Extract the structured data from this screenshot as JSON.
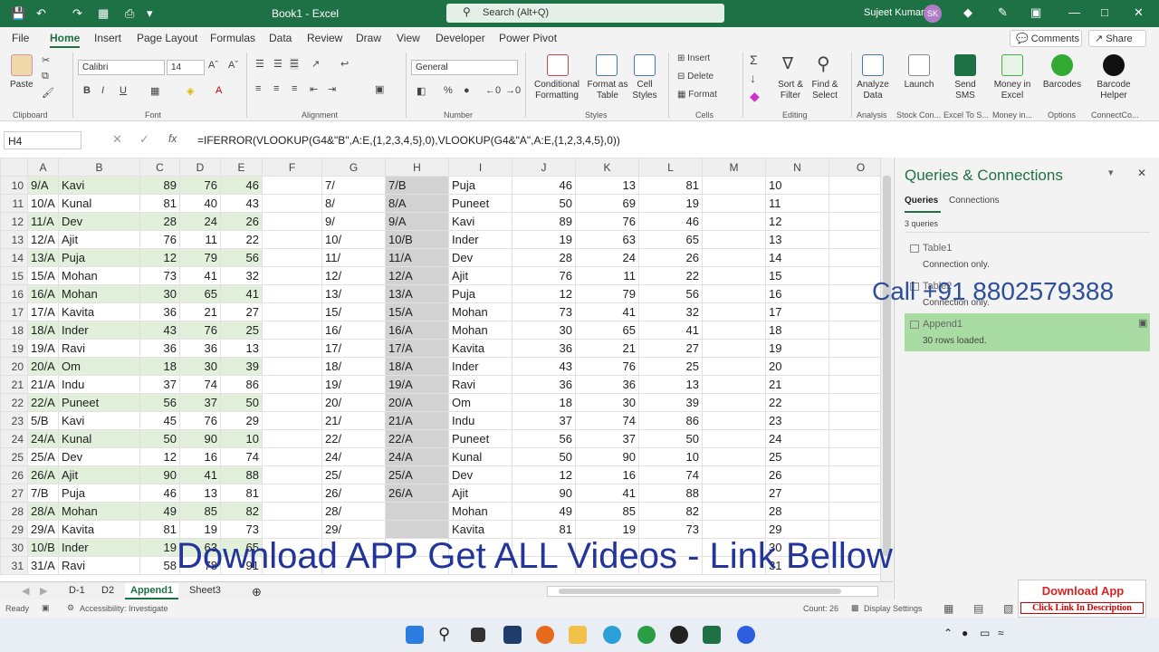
{
  "titlebar": {
    "doc_title": "Book1  -  Excel",
    "search_placeholder": "Search (Alt+Q)",
    "user": "Sujeet Kumar",
    "avatar": "SK"
  },
  "menu": {
    "tabs": [
      "File",
      "Home",
      "Insert",
      "Page Layout",
      "Formulas",
      "Data",
      "Review",
      "Draw",
      "View",
      "Developer",
      "Power Pivot"
    ],
    "comments": "Comments",
    "share": "Share"
  },
  "ribbon": {
    "clipboard": {
      "paste": "Paste",
      "label": "Clipboard"
    },
    "font": {
      "name": "Calibri",
      "size": "14",
      "label": "Font"
    },
    "alignment": {
      "label": "Alignment"
    },
    "number": {
      "format": "General",
      "label": "Number"
    },
    "styles": {
      "cond": "Conditional Formatting",
      "table": "Format as Table",
      "cell": "Cell Styles",
      "label": "Styles"
    },
    "cells": {
      "insert": "Insert",
      "delete": "Delete",
      "format": "Format",
      "label": "Cells"
    },
    "editing": {
      "sort": "Sort & Filter",
      "find": "Find & Select",
      "label": "Editing"
    },
    "analysis": {
      "btn": "Analyze Data",
      "label": "Analysis"
    },
    "stock": {
      "btn": "Launch",
      "label": "Stock Con..."
    },
    "sms": {
      "btn": "Send SMS",
      "label": "Excel To S..."
    },
    "money": {
      "btn": "Money in Excel",
      "label": "Money in..."
    },
    "options": {
      "btn": "Barcodes",
      "label": "Options"
    },
    "connect": {
      "btn": "Barcode Helper",
      "label": "ConnectCo..."
    }
  },
  "formula": {
    "cell": "H4",
    "value": "=IFERROR(VLOOKUP(G4&\"B\",A:E,{1,2,3,4,5},0),VLOOKUP(G4&\"A\",A:E,{1,2,3,4,5},0))"
  },
  "grid": {
    "columns": [
      "A",
      "B",
      "C",
      "D",
      "E",
      "F",
      "G",
      "H",
      "I",
      "J",
      "K",
      "L",
      "M",
      "N",
      "O"
    ],
    "rows": [
      {
        "n": "10",
        "a": "9/A",
        "b": "Kavi",
        "c": "89",
        "d": "76",
        "e": "46",
        "g": "7/",
        "h": "7/B",
        "i": "Puja",
        "j": "46",
        "k": "13",
        "l": "81"
      },
      {
        "n": "11",
        "a": "10/A",
        "b": "Kunal",
        "c": "81",
        "d": "40",
        "e": "43",
        "g": "8/",
        "h": "8/A",
        "i": "Puneet",
        "j": "50",
        "k": "69",
        "l": "19"
      },
      {
        "n": "12",
        "a": "11/A",
        "b": "Dev",
        "c": "28",
        "d": "24",
        "e": "26",
        "g": "9/",
        "h": "9/A",
        "i": "Kavi",
        "j": "89",
        "k": "76",
        "l": "46"
      },
      {
        "n": "13",
        "a": "12/A",
        "b": "Ajit",
        "c": "76",
        "d": "11",
        "e": "22",
        "g": "10/",
        "h": "10/B",
        "i": "Inder",
        "j": "19",
        "k": "63",
        "l": "65"
      },
      {
        "n": "14",
        "a": "13/A",
        "b": "Puja",
        "c": "12",
        "d": "79",
        "e": "56",
        "g": "11/",
        "h": "11/A",
        "i": "Dev",
        "j": "28",
        "k": "24",
        "l": "26"
      },
      {
        "n": "15",
        "a": "15/A",
        "b": "Mohan",
        "c": "73",
        "d": "41",
        "e": "32",
        "g": "12/",
        "h": "12/A",
        "i": "Ajit",
        "j": "76",
        "k": "11",
        "l": "22"
      },
      {
        "n": "16",
        "a": "16/A",
        "b": "Mohan",
        "c": "30",
        "d": "65",
        "e": "41",
        "g": "13/",
        "h": "13/A",
        "i": "Puja",
        "j": "12",
        "k": "79",
        "l": "56"
      },
      {
        "n": "17",
        "a": "17/A",
        "b": "Kavita",
        "c": "36",
        "d": "21",
        "e": "27",
        "g": "15/",
        "h": "15/A",
        "i": "Mohan",
        "j": "73",
        "k": "41",
        "l": "32"
      },
      {
        "n": "18",
        "a": "18/A",
        "b": "Inder",
        "c": "43",
        "d": "76",
        "e": "25",
        "g": "16/",
        "h": "16/A",
        "i": "Mohan",
        "j": "30",
        "k": "65",
        "l": "41"
      },
      {
        "n": "19",
        "a": "19/A",
        "b": "Ravi",
        "c": "36",
        "d": "36",
        "e": "13",
        "g": "17/",
        "h": "17/A",
        "i": "Kavita",
        "j": "36",
        "k": "21",
        "l": "27"
      },
      {
        "n": "20",
        "a": "20/A",
        "b": "Om",
        "c": "18",
        "d": "30",
        "e": "39",
        "g": "18/",
        "h": "18/A",
        "i": "Inder",
        "j": "43",
        "k": "76",
        "l": "25"
      },
      {
        "n": "21",
        "a": "21/A",
        "b": "Indu",
        "c": "37",
        "d": "74",
        "e": "86",
        "g": "19/",
        "h": "19/A",
        "i": "Ravi",
        "j": "36",
        "k": "36",
        "l": "13"
      },
      {
        "n": "22",
        "a": "22/A",
        "b": "Puneet",
        "c": "56",
        "d": "37",
        "e": "50",
        "g": "20/",
        "h": "20/A",
        "i": "Om",
        "j": "18",
        "k": "30",
        "l": "39"
      },
      {
        "n": "23",
        "a": "5/B",
        "b": "Kavi",
        "c": "45",
        "d": "76",
        "e": "29",
        "g": "21/",
        "h": "21/A",
        "i": "Indu",
        "j": "37",
        "k": "74",
        "l": "86"
      },
      {
        "n": "24",
        "a": "24/A",
        "b": "Kunal",
        "c": "50",
        "d": "90",
        "e": "10",
        "g": "22/",
        "h": "22/A",
        "i": "Puneet",
        "j": "56",
        "k": "37",
        "l": "50"
      },
      {
        "n": "25",
        "a": "25/A",
        "b": "Dev",
        "c": "12",
        "d": "16",
        "e": "74",
        "g": "24/",
        "h": "24/A",
        "i": "Kunal",
        "j": "50",
        "k": "90",
        "l": "10"
      },
      {
        "n": "26",
        "a": "26/A",
        "b": "Ajit",
        "c": "90",
        "d": "41",
        "e": "88",
        "g": "25/",
        "h": "25/A",
        "i": "Dev",
        "j": "12",
        "k": "16",
        "l": "74"
      },
      {
        "n": "27",
        "a": "7/B",
        "b": "Puja",
        "c": "46",
        "d": "13",
        "e": "81",
        "g": "26/",
        "h": "26/A",
        "i": "Ajit",
        "j": "90",
        "k": "41",
        "l": "88"
      },
      {
        "n": "28",
        "a": "28/A",
        "b": "Mohan",
        "c": "49",
        "d": "85",
        "e": "82",
        "g": "28/",
        "h": "",
        "i": "Mohan",
        "j": "49",
        "k": "85",
        "l": "82"
      },
      {
        "n": "29",
        "a": "29/A",
        "b": "Kavita",
        "c": "81",
        "d": "19",
        "e": "73",
        "g": "29/",
        "h": "",
        "i": "Kavita",
        "j": "81",
        "k": "19",
        "l": "73"
      },
      {
        "n": "30",
        "a": "10/B",
        "b": "Inder",
        "c": "19",
        "d": "63",
        "e": "65",
        "g": "",
        "h": "",
        "i": "",
        "j": "",
        "k": "",
        "l": ""
      },
      {
        "n": "31",
        "a": "31/A",
        "b": "Ravi",
        "c": "58",
        "d": "78",
        "e": "91",
        "g": "",
        "h": "",
        "i": "",
        "j": "",
        "k": "",
        "l": ""
      }
    ]
  },
  "sheets": [
    "D-1",
    "D2",
    "Append1",
    "Sheet3"
  ],
  "status": {
    "ready": "Ready",
    "accessibility": "Accessibility: Investigate",
    "count": "Count: 26",
    "display": "Display Settings"
  },
  "panel": {
    "title": "Queries & Connections",
    "tabs": [
      "Queries",
      "Connections"
    ],
    "count": "3 queries",
    "items": [
      {
        "name": "Table1",
        "status": "Connection only."
      },
      {
        "name": "Table2",
        "status": "Connection only."
      },
      {
        "name": "Append1",
        "status": "30 rows loaded."
      }
    ]
  },
  "overlays": {
    "phone": "Call +91 8802579388",
    "download": "Download APP Get ALL Videos -  Link Bellow",
    "dl_title": "Download App",
    "dl_sub": "Click Link In Description"
  },
  "colors": {
    "excel_green": "#1e7145",
    "table_fill": "#e2efda",
    "selected_col": "#d2d2d2"
  }
}
